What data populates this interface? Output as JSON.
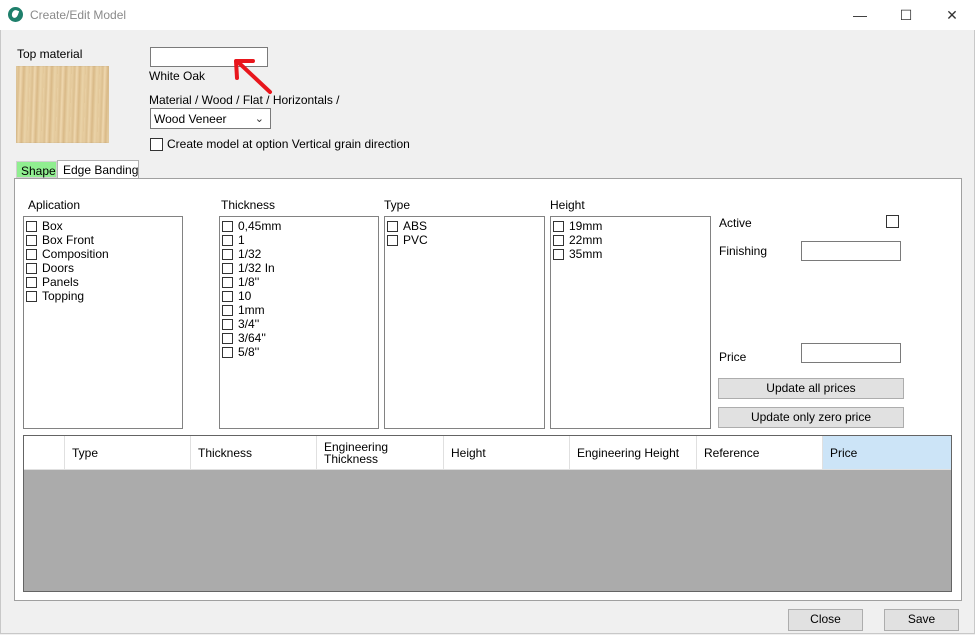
{
  "window": {
    "title": "Create/Edit Model",
    "controls": {
      "minimize": "—",
      "maximize": "☐",
      "close": "✕"
    }
  },
  "top": {
    "top_material_label": "Top material",
    "material_input_value": "",
    "material_name": "White Oak",
    "material_path": "Material  / Wood / Flat / Horizontals /",
    "veneer_select": "Wood Veneer",
    "vertical_grain_checkbox_label": "Create model at option Vertical grain direction",
    "vertical_grain_checked": false
  },
  "tabs": [
    {
      "label": "Shape",
      "active": true
    },
    {
      "label": "Edge Banding",
      "active": false
    }
  ],
  "lists": {
    "application": {
      "header": "Aplication",
      "items": [
        "Box",
        "Box Front",
        "Composition",
        "Doors",
        "Panels",
        "Topping"
      ]
    },
    "thickness": {
      "header": "Thickness",
      "items": [
        "0,45mm",
        "1",
        "1/32",
        "1/32 In",
        "1/8''",
        "10",
        "1mm",
        "3/4''",
        "3/64''",
        "5/8''"
      ]
    },
    "type": {
      "header": "Type",
      "items": [
        "ABS",
        "PVC"
      ]
    },
    "height": {
      "header": "Height",
      "items": [
        "19mm",
        "22mm",
        "35mm"
      ]
    }
  },
  "right": {
    "active_label": "Active",
    "active_checked": false,
    "finishing_label": "Finishing",
    "finishing_value": "",
    "price_label": "Price",
    "price_value": "",
    "update_all_button": "Update all prices",
    "update_zero_button": "Update only zero price"
  },
  "grid": {
    "columns": [
      "",
      "Type",
      "Thickness",
      "Engineering\nThickness",
      "Height",
      "Engineering Height",
      "Reference",
      "Price"
    ],
    "selected_column": "Price",
    "rows": []
  },
  "footer": {
    "close_button": "Close",
    "save_button": "Save"
  },
  "colors": {
    "active_tab": "#90ee90",
    "grid_background": "#ababab",
    "selected_header": "#cce4f7",
    "annotation_arrow": "#e8161c"
  }
}
